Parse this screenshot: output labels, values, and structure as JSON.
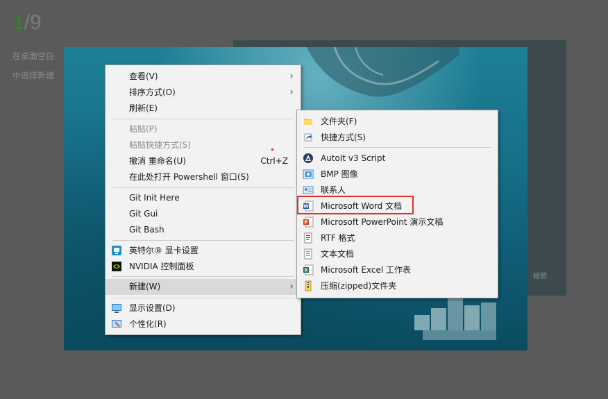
{
  "page": {
    "counter_current": "1",
    "counter_total": "/9",
    "instruction_line1": "在桌面空白",
    "instruction_line2": "中选择新建",
    "watermark": "经验"
  },
  "context_menu": {
    "view": "查看(V)",
    "sort_by": "排序方式(O)",
    "refresh": "刷新(E)",
    "paste": "粘贴(P)",
    "paste_shortcut": "粘贴快捷方式(S)",
    "undo_rename": "撤消 重命名(U)",
    "undo_shortcut": "Ctrl+Z",
    "open_powershell": "在此处打开 Powershell 窗口(S)",
    "git_init": "Git Init Here",
    "git_gui": "Git Gui",
    "git_bash": "Git Bash",
    "intel_graphics": "英特尔® 显卡设置",
    "nvidia_panel": "NVIDIA 控制面板",
    "new": "新建(W)",
    "display_settings": "显示设置(D)",
    "personalize": "个性化(R)"
  },
  "new_submenu": {
    "folder": "文件夹(F)",
    "shortcut": "快捷方式(S)",
    "autoit": "AutoIt v3 Script",
    "bmp": "BMP 图像",
    "contact": "联系人",
    "word": "Microsoft Word 文档",
    "powerpoint": "Microsoft PowerPoint 演示文稿",
    "rtf": "RTF 格式",
    "text": "文本文档",
    "excel": "Microsoft Excel 工作表",
    "zip": "压缩(zipped)文件夹"
  },
  "colors": {
    "highlight_box": "#e0302a",
    "menu_bg": "#f2f2f2",
    "counter_accent": "#2a8a2a"
  }
}
